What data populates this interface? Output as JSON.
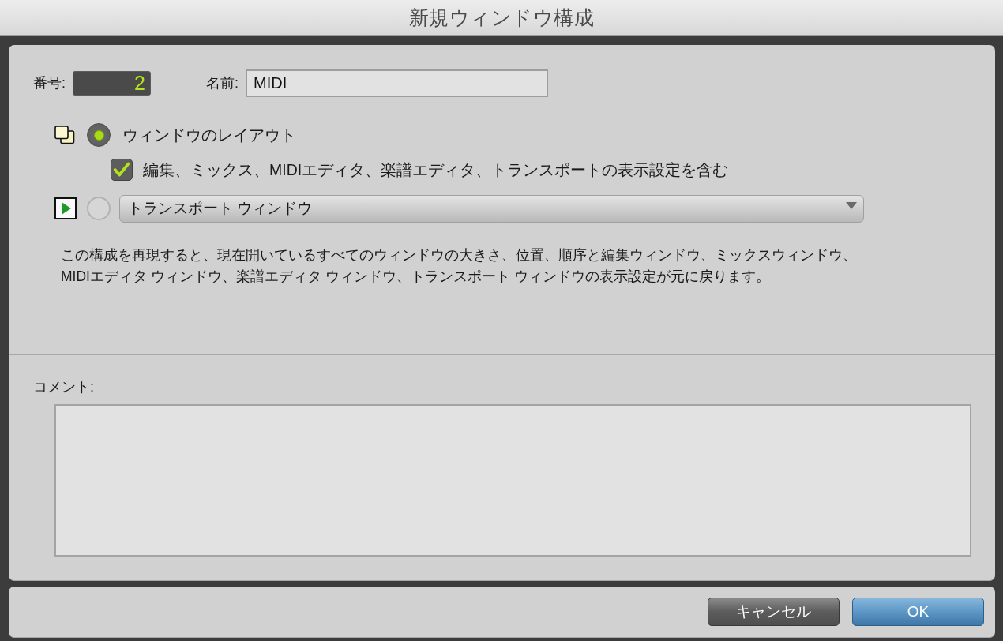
{
  "window": {
    "title": "新規ウィンドウ構成"
  },
  "number": {
    "label": "番号:",
    "value": "2"
  },
  "name": {
    "label": "名前:",
    "value": "MIDI"
  },
  "options": [
    {
      "kind": "layout",
      "selected": true,
      "label": "ウィンドウのレイアウト",
      "sub_option": {
        "label": "編集、ミックス、MIDIエディタ、楽譜エディタ、トランスポートの表示設定を含む",
        "checked": true
      }
    },
    {
      "kind": "window",
      "selected": false,
      "dropdown": {
        "value": "トランスポート ウィンドウ"
      }
    }
  ],
  "description": "この構成を再現すると、現在開いているすべてのウィンドウの大きさ、位置、順序と編集ウィンドウ、ミックスウィンドウ、MIDIエディタ ウィンドウ、楽譜エディタ ウィンドウ、トランスポート ウィンドウの表示設定が元に戻ります。",
  "comment": {
    "label": "コメント:"
  },
  "buttons": [
    {
      "kind": "secondary",
      "label": "キャンセル"
    },
    {
      "kind": "default",
      "label": "OK"
    }
  ]
}
